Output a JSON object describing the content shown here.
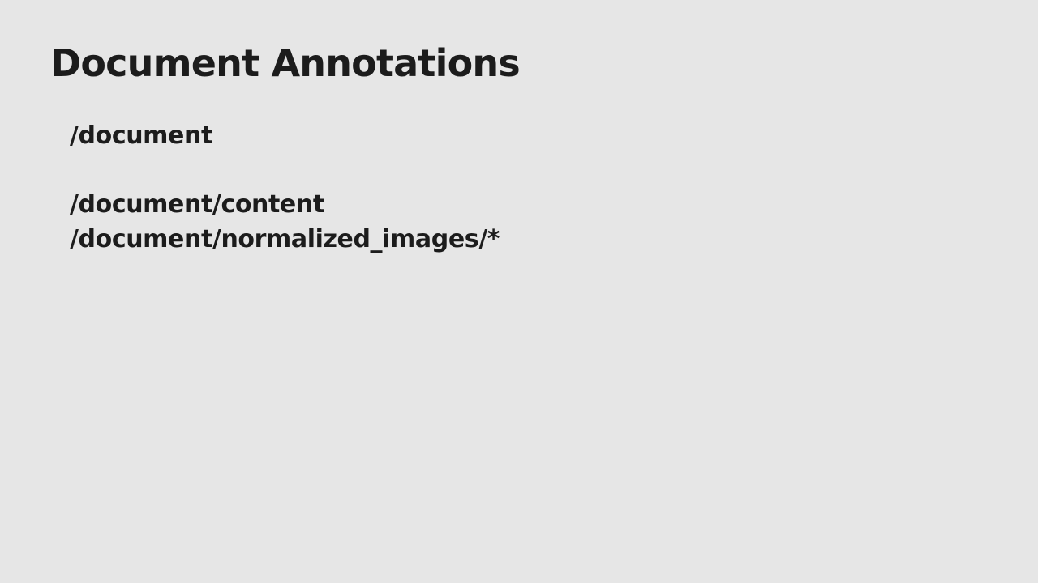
{
  "slide": {
    "title": "Document Annotations",
    "paths": [
      "/document",
      "/document/content",
      "/document/normalized_images/*"
    ]
  }
}
